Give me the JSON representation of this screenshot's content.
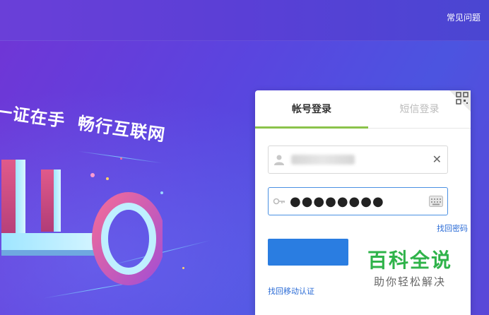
{
  "header": {
    "faq_link": "常见问题"
  },
  "hero": {
    "slogan_part1": "一证在手",
    "slogan_part2": "畅行互联网"
  },
  "login": {
    "tab_account": "帐号登录",
    "tab_sms": "短信登录",
    "password_mask": "●●●●●●●●",
    "clear_symbol": "✕",
    "forgot_password": "找回密码",
    "login_button": "",
    "forgot_mobile": "找回移动认证"
  },
  "watermark": {
    "title": "百科全说",
    "subtitle": "助你轻松解决"
  },
  "colors": {
    "accent_tab": "#8bc34a",
    "login_button": "#2a7de1",
    "link": "#2a6bd6",
    "watermark_green": "#2fb34a"
  }
}
